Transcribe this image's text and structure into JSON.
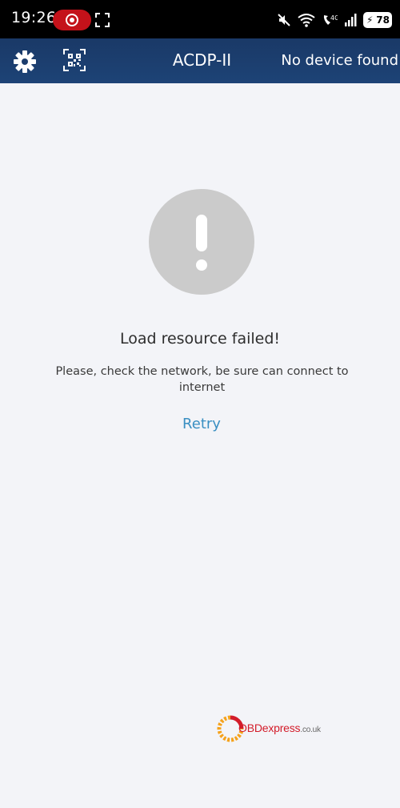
{
  "status_bar": {
    "time": "19:26",
    "battery_level": "78"
  },
  "app_bar": {
    "title": "ACDP-II",
    "device_status": "No device found"
  },
  "error": {
    "title": "Load resource failed!",
    "message": "Please, check the network, be sure can connect to internet",
    "retry_label": "Retry"
  },
  "watermark": {
    "brand": "OBDexpress",
    "domain": ".co.uk"
  },
  "colors": {
    "header": "#1a3967",
    "link": "#3a8fc2",
    "background": "#f3f4f8",
    "error_circle": "#cbcbcb"
  }
}
